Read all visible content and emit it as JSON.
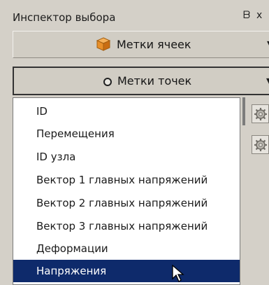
{
  "window": {
    "title": "Инспектор выбора",
    "float_icon": "restore-window-icon",
    "float_glyph": "ᗷ",
    "close_glyph": "x"
  },
  "cell_labels": {
    "label": "Метки ячеек",
    "icon": "cube-icon",
    "expanded": false
  },
  "point_labels": {
    "label": "Метки точек",
    "icon": "circle-dot-icon",
    "expanded": true
  },
  "menu": {
    "items": [
      {
        "label": "ID"
      },
      {
        "label": "Перемещения"
      },
      {
        "label": "ID узла"
      },
      {
        "label": "Вектор 1 главных напряжений"
      },
      {
        "label": "Вектор 2 главных напряжений"
      },
      {
        "label": "Вектор 3 главных напряжений"
      },
      {
        "label": "Деформации"
      },
      {
        "label": "Напряжения"
      }
    ],
    "selected_index": 7
  },
  "colors": {
    "selection": "#0e2a6b",
    "panel": "#d4d0c8",
    "cube": "#e8902a"
  }
}
